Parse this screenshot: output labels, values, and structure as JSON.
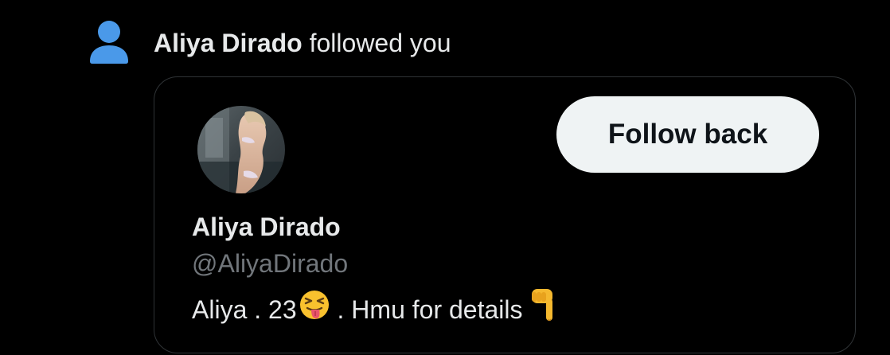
{
  "notification": {
    "actor_name": "Aliya Dirado",
    "action_text": " followed you",
    "icon": "person-icon",
    "icon_color": "#4a99e9"
  },
  "profile_card": {
    "avatar": "profile-photo",
    "display_name": "Aliya Dirado",
    "handle": "@AliyaDirado",
    "bio": {
      "part1": "Aliya . 23",
      "emoji1": "squinting-face-with-tongue-emoji",
      "part2": " . Hmu for details",
      "emoji2": "backhand-index-pointing-down-emoji"
    },
    "follow_button_label": "Follow back"
  },
  "colors": {
    "background": "#000000",
    "text_primary": "#e7e9ea",
    "text_secondary": "#71767b",
    "card_border": "#2f3336",
    "button_bg": "#eff3f4",
    "button_text": "#0f1419"
  }
}
